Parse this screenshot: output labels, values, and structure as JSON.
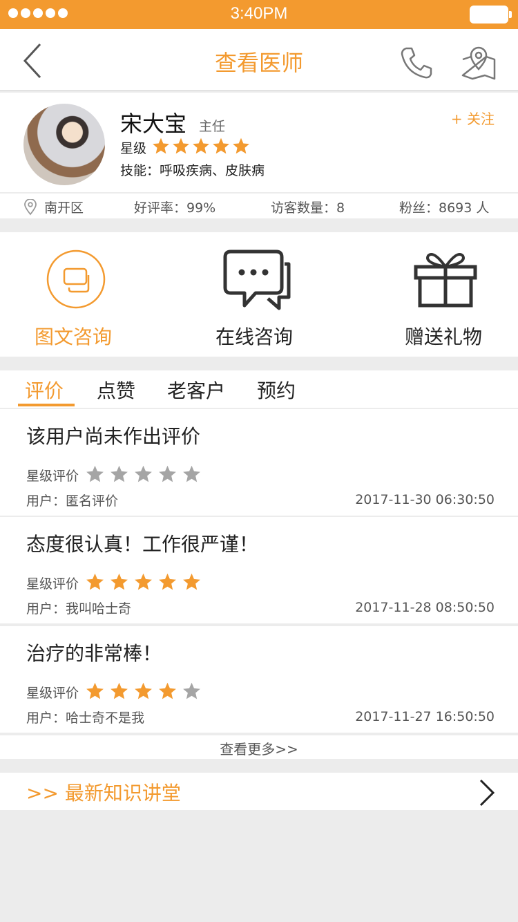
{
  "status_bar": {
    "time": "3:40PM"
  },
  "nav": {
    "title": "查看医师",
    "back_icon": "chevron-left-icon",
    "phone_icon": "phone-icon",
    "map_icon": "map-pin-icon"
  },
  "doctor": {
    "name": "宋大宝",
    "title": "主任",
    "follow_label": "+ 关注",
    "star_label": "星级",
    "stars": 5,
    "skills": "技能：呼吸疾病、皮肤病",
    "district": "南开区",
    "good_rate": "好评率：99%",
    "visitors": "访客数量：8",
    "fans": "粉丝：8693 人"
  },
  "services": [
    {
      "label": "图文咨询",
      "icon": "chat-image-icon"
    },
    {
      "label": "在线咨询",
      "icon": "chat-bubble-icon"
    },
    {
      "label": "赠送礼物",
      "icon": "gift-icon"
    }
  ],
  "tabs": [
    "评价",
    "点赞",
    "老客户",
    "预约"
  ],
  "reviews": [
    {
      "text": "该用户尚未作出评价",
      "star_label": "星级评价",
      "stars": 0,
      "user": "用户：匿名评价",
      "date": "2017-11-30 06:30:50"
    },
    {
      "text": "态度很认真！工作很严谨！",
      "star_label": "星级评价",
      "stars": 5,
      "user": "用户：我叫哈士奇",
      "date": "2017-11-28 08:50:50"
    },
    {
      "text": "治疗的非常棒！",
      "star_label": "星级评价",
      "stars": 4,
      "user": "用户：哈士奇不是我",
      "date": "2017-11-27 16:50:50"
    }
  ],
  "more_label": "查看更多>>",
  "lecture": {
    "label": ">> 最新知识讲堂"
  },
  "colors": {
    "accent": "#f39a2f",
    "star_gray": "#a5a5a5"
  }
}
